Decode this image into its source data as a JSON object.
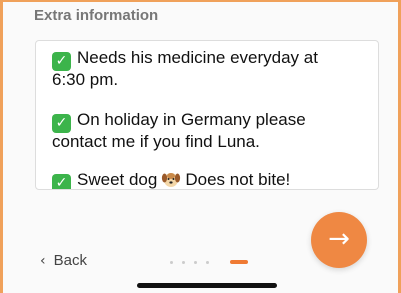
{
  "section": {
    "label": "Extra information"
  },
  "notes": {
    "line1": "Needs his medicine everyday at",
    "line2": "6:30 pm.",
    "line3": "On holiday in Germany please",
    "line4": "contact me if you find Luna.",
    "line5_a": "Sweet dog",
    "line5_b": "Does not bite!",
    "check_glyph": "✓"
  },
  "nav": {
    "back_label": "Back",
    "back_glyph": "‹",
    "next_glyph": "→",
    "pages_total": 5,
    "current_page": 5
  },
  "colors": {
    "accent": "#ef8843",
    "check": "#3cb44b",
    "frame": "#f0a15a"
  }
}
